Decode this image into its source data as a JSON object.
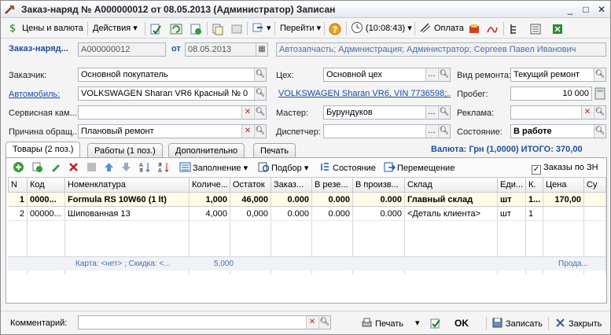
{
  "window": {
    "title": "Заказ-наряд № А000000012 от 08.05.2013 (Администратор) Записан",
    "minimize": "_",
    "maximize": "□",
    "close": "✕"
  },
  "toolbar": {
    "prices_currency": "Цены и валюта",
    "actions": "Действия",
    "goto": "Перейти",
    "time": "(10:08:43)",
    "payment": "Оплата"
  },
  "header": {
    "order_label": "Заказ-наряд...",
    "order_number": "А000000012",
    "date_label": "от",
    "date_value": "08.05.2013",
    "org_info": "Автозапчасть; Администрация; Администратор; Сергеев Павел Иванович"
  },
  "form": {
    "customer_label": "Заказчик:",
    "customer_value": "Основной покупатель",
    "car_label": "Автомобиль:",
    "car_value": "VOLKSWAGEN Sharan VR6 Красный № 0",
    "service_label": "Сервисная кам...",
    "service_value": "",
    "reason_label": "Причина обращ...",
    "reason_value": "Плановый ремонт",
    "shop_label": "Цех:",
    "shop_value": "Основной цех",
    "car_link": "VOLKSWAGEN Sharan VR6, VIN 7736598;...",
    "master_label": "Мастер:",
    "master_value": "Бурундуков",
    "dispatcher_label": "Диспетчер:",
    "dispatcher_value": "",
    "repair_type_label": "Вид ремонта:",
    "repair_type_value": "Текущий ремонт",
    "mileage_label": "Пробег:",
    "mileage_value": "10 000",
    "ads_label": "Реклама:",
    "ads_value": "",
    "state_label": "Состояние:",
    "state_value": "В работе"
  },
  "tabs": [
    {
      "label": "Товары (2 поз.)"
    },
    {
      "label": "Работы (1 поз.)"
    },
    {
      "label": "Дополнительно"
    },
    {
      "label": "Печать"
    }
  ],
  "totals": "Валюта: Грн (1,0000) ИТОГО: 370,00",
  "grid_toolbar": {
    "fill": "Заполнение",
    "selection": "Подбор",
    "state": "Состояние",
    "move": "Перемещение",
    "orders_checkbox": "Заказы по ЗН"
  },
  "grid": {
    "columns": [
      "N",
      "Код",
      "Номенклатура",
      "Количе...",
      "Остаток",
      "Заказ...",
      "В резе...",
      "В произв...",
      "Склад",
      "Еди...",
      "К.",
      "Цена",
      "Су"
    ],
    "rows": [
      [
        "1",
        "0000...",
        "Formula RS 10W60 (1 lt)",
        "1,000",
        "46,000",
        "0.000",
        "0.000",
        "0.000",
        "Главный склад",
        "шт",
        "1...",
        "170,00",
        ""
      ],
      [
        "2",
        "00000...",
        "Шипованная 13",
        "4,000",
        "0,000",
        "0.000",
        "0.000",
        "0.000",
        "<Деталь клиента>",
        "шт",
        "1",
        "",
        ""
      ]
    ],
    "footer_card": "Карта: <нет> ; Скидка: <...",
    "footer_qty": "5,000",
    "footer_right": "Прода..."
  },
  "bottom": {
    "comment_label": "Комментарий:",
    "comment_value": "",
    "print": "Печать",
    "ok": "OK",
    "save": "Записать",
    "close": "Закрыть"
  }
}
